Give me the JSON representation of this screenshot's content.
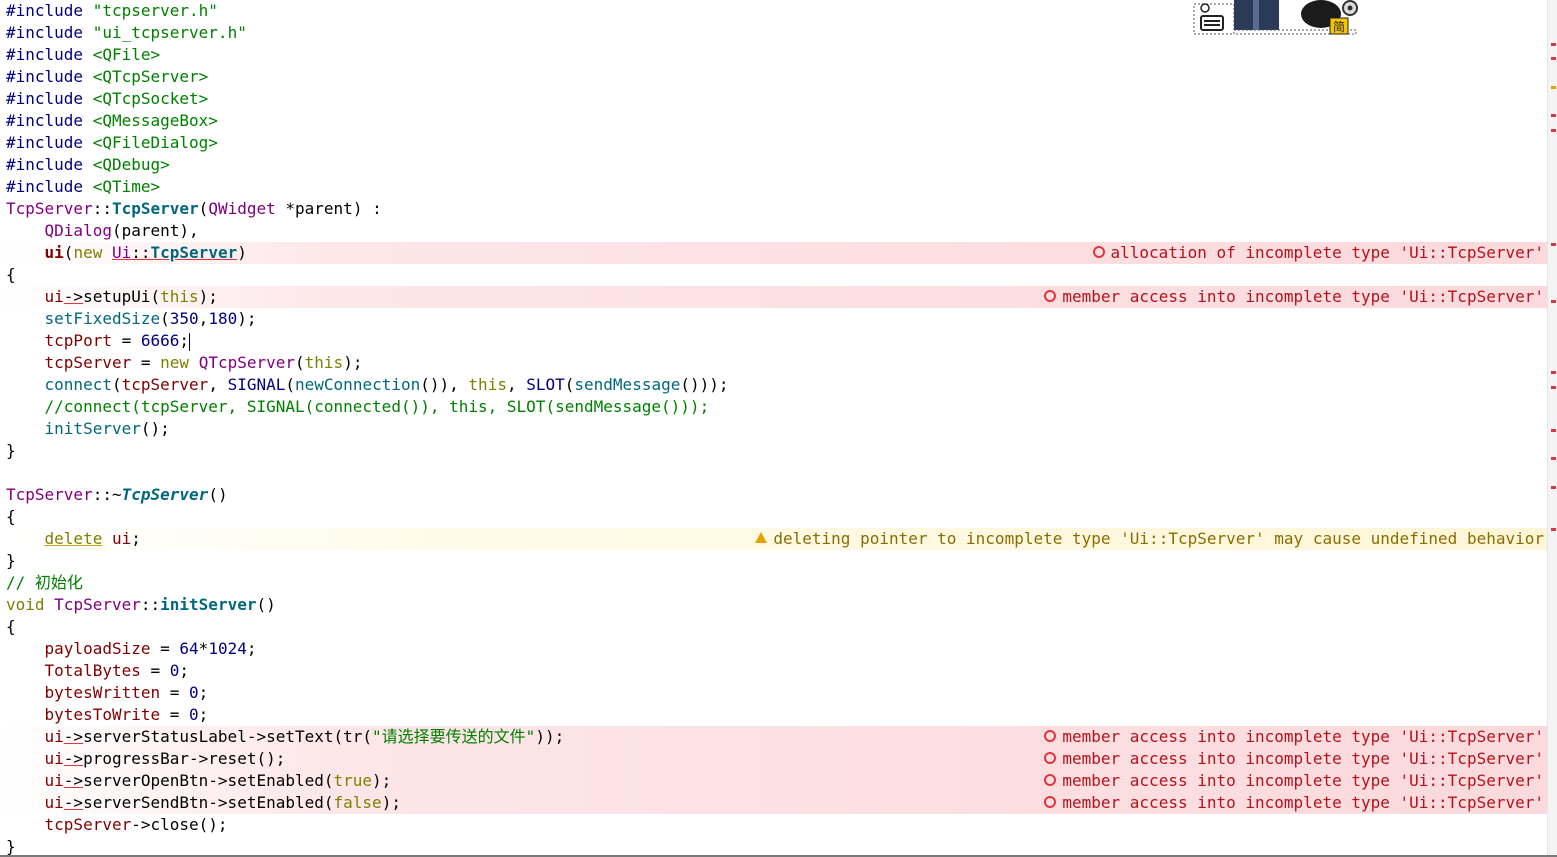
{
  "editor": {
    "lines": [
      {
        "tokens": [
          {
            "t": "#include ",
            "c": "pre"
          },
          {
            "t": "\"tcpserver.h\"",
            "c": "str"
          }
        ]
      },
      {
        "tokens": [
          {
            "t": "#include ",
            "c": "pre"
          },
          {
            "t": "\"ui_tcpserver.h\"",
            "c": "str"
          }
        ]
      },
      {
        "tokens": [
          {
            "t": "#include ",
            "c": "pre"
          },
          {
            "t": "<QFile>",
            "c": "str"
          }
        ]
      },
      {
        "tokens": [
          {
            "t": "#include ",
            "c": "pre"
          },
          {
            "t": "<QTcpServer>",
            "c": "str"
          }
        ]
      },
      {
        "tokens": [
          {
            "t": "#include ",
            "c": "pre"
          },
          {
            "t": "<QTcpSocket>",
            "c": "str"
          }
        ]
      },
      {
        "tokens": [
          {
            "t": "#include ",
            "c": "pre"
          },
          {
            "t": "<QMessageBox>",
            "c": "str"
          }
        ]
      },
      {
        "tokens": [
          {
            "t": "#include ",
            "c": "pre"
          },
          {
            "t": "<QFileDialog>",
            "c": "str"
          }
        ]
      },
      {
        "tokens": [
          {
            "t": "#include ",
            "c": "pre"
          },
          {
            "t": "<QDebug>",
            "c": "str"
          }
        ]
      },
      {
        "tokens": [
          {
            "t": "#include ",
            "c": "pre"
          },
          {
            "t": "<QTime>",
            "c": "str"
          }
        ]
      },
      {
        "tokens": [
          {
            "t": "TcpServer",
            "c": "type"
          },
          {
            "t": "::",
            "c": "default"
          },
          {
            "t": "TcpServer",
            "c": "fnb"
          },
          {
            "t": "(",
            "c": "default"
          },
          {
            "t": "QWidget",
            "c": "type"
          },
          {
            "t": " *parent) :",
            "c": "default"
          }
        ]
      },
      {
        "tokens": [
          {
            "t": "    ",
            "c": "default"
          },
          {
            "t": "QDialog",
            "c": "type"
          },
          {
            "t": "(parent),",
            "c": "default"
          }
        ]
      },
      {
        "tokens": [
          {
            "t": "    ",
            "c": "default"
          },
          {
            "t": "ui",
            "c": "memb"
          },
          {
            "t": "(",
            "c": "default"
          },
          {
            "t": "new",
            "c": "kw"
          },
          {
            "t": " ",
            "c": "default"
          },
          {
            "t": "Ui",
            "c": "typeu"
          },
          {
            "t": "::",
            "c": "defu"
          },
          {
            "t": "TcpServer",
            "c": "fnbu"
          },
          {
            "t": ")",
            "c": "default"
          }
        ],
        "diag": {
          "kind": "error",
          "text": "allocation of incomplete type 'Ui::TcpServer'"
        }
      },
      {
        "tokens": [
          {
            "t": "{",
            "c": "default"
          }
        ]
      },
      {
        "tokens": [
          {
            "t": "    ",
            "c": "default"
          },
          {
            "t": "ui",
            "c": "mem"
          },
          {
            "t": "->",
            "c": "defu"
          },
          {
            "t": "setupUi(",
            "c": "default"
          },
          {
            "t": "this",
            "c": "kw"
          },
          {
            "t": ");",
            "c": "default"
          }
        ],
        "diag": {
          "kind": "error",
          "text": "member access into incomplete type 'Ui::TcpServer'"
        }
      },
      {
        "tokens": [
          {
            "t": "    ",
            "c": "default"
          },
          {
            "t": "setFixedSize",
            "c": "fn"
          },
          {
            "t": "(",
            "c": "default"
          },
          {
            "t": "350",
            "c": "num"
          },
          {
            "t": ",",
            "c": "default"
          },
          {
            "t": "180",
            "c": "num"
          },
          {
            "t": ");",
            "c": "default"
          }
        ]
      },
      {
        "tokens": [
          {
            "t": "    ",
            "c": "default"
          },
          {
            "t": "tcpPort",
            "c": "mem"
          },
          {
            "t": " = ",
            "c": "default"
          },
          {
            "t": "6666",
            "c": "num"
          },
          {
            "t": ";",
            "c": "default"
          }
        ],
        "cursor": true
      },
      {
        "tokens": [
          {
            "t": "    ",
            "c": "default"
          },
          {
            "t": "tcpServer",
            "c": "mem"
          },
          {
            "t": " = ",
            "c": "default"
          },
          {
            "t": "new",
            "c": "kw"
          },
          {
            "t": " ",
            "c": "default"
          },
          {
            "t": "QTcpServer",
            "c": "type"
          },
          {
            "t": "(",
            "c": "default"
          },
          {
            "t": "this",
            "c": "kw"
          },
          {
            "t": ");",
            "c": "default"
          }
        ]
      },
      {
        "tokens": [
          {
            "t": "    ",
            "c": "default"
          },
          {
            "t": "connect",
            "c": "fn"
          },
          {
            "t": "(",
            "c": "default"
          },
          {
            "t": "tcpServer",
            "c": "mem"
          },
          {
            "t": ", ",
            "c": "default"
          },
          {
            "t": "SIGNAL",
            "c": "macro"
          },
          {
            "t": "(",
            "c": "default"
          },
          {
            "t": "newConnection",
            "c": "fn"
          },
          {
            "t": "()), ",
            "c": "default"
          },
          {
            "t": "this",
            "c": "kw"
          },
          {
            "t": ", ",
            "c": "default"
          },
          {
            "t": "SLOT",
            "c": "macro"
          },
          {
            "t": "(",
            "c": "default"
          },
          {
            "t": "sendMessage",
            "c": "fn"
          },
          {
            "t": "()));",
            "c": "default"
          }
        ]
      },
      {
        "tokens": [
          {
            "t": "    ",
            "c": "default"
          },
          {
            "t": "//connect(tcpServer, SIGNAL(connected()), this, SLOT(sendMessage()));",
            "c": "com"
          }
        ]
      },
      {
        "tokens": [
          {
            "t": "    ",
            "c": "default"
          },
          {
            "t": "initServer",
            "c": "fn"
          },
          {
            "t": "();",
            "c": "default"
          }
        ]
      },
      {
        "tokens": [
          {
            "t": "}",
            "c": "default"
          }
        ]
      },
      {
        "tokens": []
      },
      {
        "tokens": [
          {
            "t": "TcpServer",
            "c": "type"
          },
          {
            "t": "::~",
            "c": "default"
          },
          {
            "t": "TcpServer",
            "c": "fni"
          },
          {
            "t": "()",
            "c": "default"
          }
        ]
      },
      {
        "tokens": [
          {
            "t": "{",
            "c": "default"
          }
        ]
      },
      {
        "tokens": [
          {
            "t": "    ",
            "c": "default"
          },
          {
            "t": "delete",
            "c": "kwuw"
          },
          {
            "t": " ",
            "c": "default"
          },
          {
            "t": "ui",
            "c": "mem"
          },
          {
            "t": ";",
            "c": "default"
          }
        ],
        "diag": {
          "kind": "warning",
          "text": "deleting pointer to incomplete type 'Ui::TcpServer' may cause undefined behavior"
        }
      },
      {
        "tokens": [
          {
            "t": "}",
            "c": "default"
          }
        ]
      },
      {
        "tokens": [
          {
            "t": "// 初始化",
            "c": "com"
          }
        ]
      },
      {
        "tokens": [
          {
            "t": "void",
            "c": "kw"
          },
          {
            "t": " ",
            "c": "default"
          },
          {
            "t": "TcpServer",
            "c": "type"
          },
          {
            "t": "::",
            "c": "default"
          },
          {
            "t": "initServer",
            "c": "fnb"
          },
          {
            "t": "()",
            "c": "default"
          }
        ]
      },
      {
        "tokens": [
          {
            "t": "{",
            "c": "default"
          }
        ]
      },
      {
        "tokens": [
          {
            "t": "    ",
            "c": "default"
          },
          {
            "t": "payloadSize",
            "c": "mem"
          },
          {
            "t": " = ",
            "c": "default"
          },
          {
            "t": "64",
            "c": "num"
          },
          {
            "t": "*",
            "c": "default"
          },
          {
            "t": "1024",
            "c": "num"
          },
          {
            "t": ";",
            "c": "default"
          }
        ]
      },
      {
        "tokens": [
          {
            "t": "    ",
            "c": "default"
          },
          {
            "t": "TotalBytes",
            "c": "mem"
          },
          {
            "t": " = ",
            "c": "default"
          },
          {
            "t": "0",
            "c": "num"
          },
          {
            "t": ";",
            "c": "default"
          }
        ]
      },
      {
        "tokens": [
          {
            "t": "    ",
            "c": "default"
          },
          {
            "t": "bytesWritten",
            "c": "mem"
          },
          {
            "t": " = ",
            "c": "default"
          },
          {
            "t": "0",
            "c": "num"
          },
          {
            "t": ";",
            "c": "default"
          }
        ]
      },
      {
        "tokens": [
          {
            "t": "    ",
            "c": "default"
          },
          {
            "t": "bytesToWrite",
            "c": "mem"
          },
          {
            "t": " = ",
            "c": "default"
          },
          {
            "t": "0",
            "c": "num"
          },
          {
            "t": ";",
            "c": "default"
          }
        ]
      },
      {
        "tokens": [
          {
            "t": "    ",
            "c": "default"
          },
          {
            "t": "ui",
            "c": "mem"
          },
          {
            "t": "->",
            "c": "defu"
          },
          {
            "t": "serverStatusLabel->setText(tr(",
            "c": "default"
          },
          {
            "t": "\"请选择要传送的文件\"",
            "c": "str"
          },
          {
            "t": "));",
            "c": "default"
          }
        ],
        "diag": {
          "kind": "error",
          "text": "member access into incomplete type 'Ui::TcpServer'"
        }
      },
      {
        "tokens": [
          {
            "t": "    ",
            "c": "default"
          },
          {
            "t": "ui",
            "c": "mem"
          },
          {
            "t": "->",
            "c": "defu"
          },
          {
            "t": "progressBar->reset();",
            "c": "default"
          }
        ],
        "diag": {
          "kind": "error",
          "text": "member access into incomplete type 'Ui::TcpServer'"
        }
      },
      {
        "tokens": [
          {
            "t": "    ",
            "c": "default"
          },
          {
            "t": "ui",
            "c": "mem"
          },
          {
            "t": "->",
            "c": "defu"
          },
          {
            "t": "serverOpenBtn->setEnabled(",
            "c": "default"
          },
          {
            "t": "true",
            "c": "kw"
          },
          {
            "t": ");",
            "c": "default"
          }
        ],
        "diag": {
          "kind": "error",
          "text": "member access into incomplete type 'Ui::TcpServer'"
        }
      },
      {
        "tokens": [
          {
            "t": "    ",
            "c": "default"
          },
          {
            "t": "ui",
            "c": "mem"
          },
          {
            "t": "->",
            "c": "defu"
          },
          {
            "t": "serverSendBtn->setEnabled(",
            "c": "default"
          },
          {
            "t": "false",
            "c": "kw"
          },
          {
            "t": ");",
            "c": "default"
          }
        ],
        "diag": {
          "kind": "error",
          "text": "member access into incomplete type 'Ui::TcpServer'"
        }
      },
      {
        "tokens": [
          {
            "t": "    ",
            "c": "default"
          },
          {
            "t": "tcpServer",
            "c": "mem"
          },
          {
            "t": "->close();",
            "c": "default"
          }
        ]
      },
      {
        "tokens": [
          {
            "t": "}",
            "c": "default"
          }
        ]
      }
    ]
  },
  "annotation_bar": {
    "markers": [
      {
        "kind": "error",
        "line": 3
      },
      {
        "kind": "error",
        "line": 4
      },
      {
        "kind": "warning",
        "line": 6
      },
      {
        "kind": "error",
        "line": 8
      },
      {
        "kind": "error",
        "line": 9
      },
      {
        "kind": "error",
        "line": 17
      },
      {
        "kind": "error",
        "line": 21
      },
      {
        "kind": "error",
        "line": 26
      },
      {
        "kind": "error",
        "line": 27
      },
      {
        "kind": "error",
        "line": 30
      },
      {
        "kind": "error",
        "line": 32
      },
      {
        "kind": "error",
        "line": 34
      },
      {
        "kind": "error",
        "line": 37
      }
    ]
  },
  "colors": {
    "error": "#e2343d",
    "warning": "#e2a200"
  },
  "icons": {
    "mascot": "input-method-mascot-icon",
    "keyboard": "keyboard-icon",
    "gear": "gear-icon",
    "simplified_badge": "简"
  }
}
